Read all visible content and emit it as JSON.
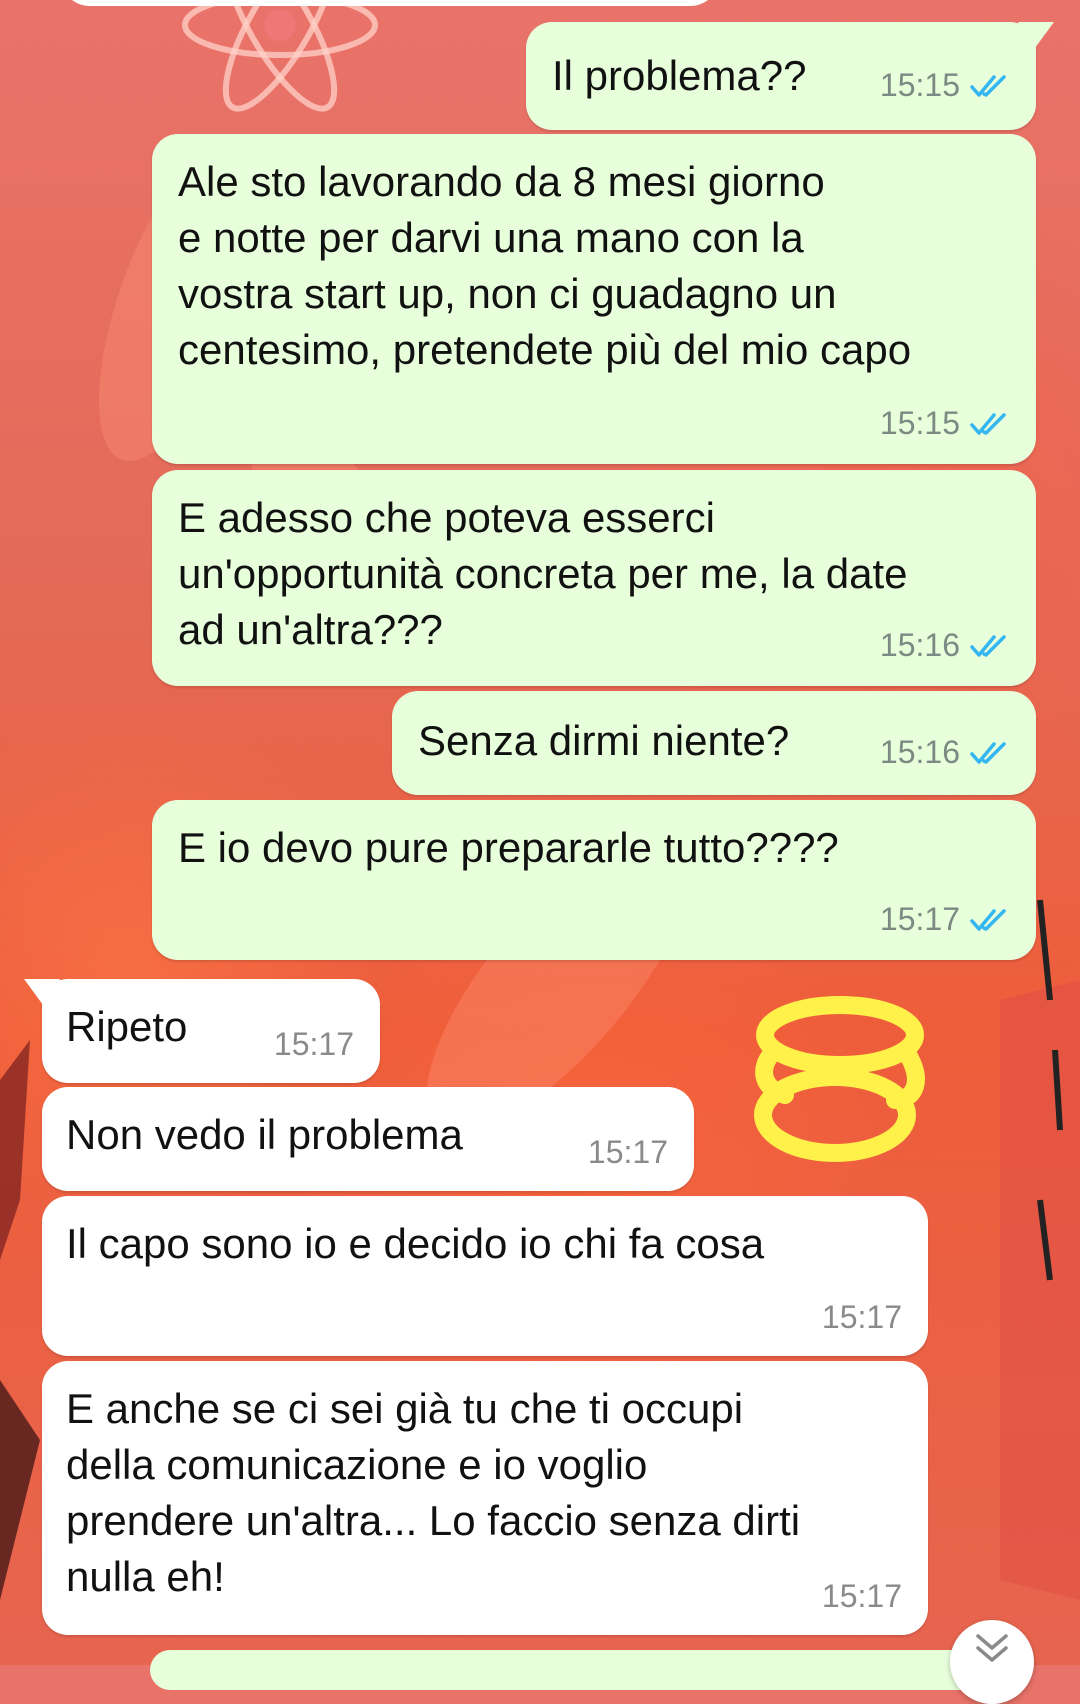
{
  "chat": {
    "messages": [
      {
        "direction": "outgoing",
        "text": "Il problema??",
        "time": "15:15",
        "status": "read"
      },
      {
        "direction": "outgoing",
        "text": "Ale sto lavorando da 8 mesi giorno\ne notte per darvi una mano con la\nvostra start up, non ci guadagno un\ncentesimo, pretendete più del mio capo",
        "time": "15:15",
        "status": "read"
      },
      {
        "direction": "outgoing",
        "text": "E adesso che poteva esserci\nun'opportunità concreta per me, la date\nad un'altra???",
        "time": "15:16",
        "status": "read"
      },
      {
        "direction": "outgoing",
        "text": "Senza dirmi niente?",
        "time": "15:16",
        "status": "read"
      },
      {
        "direction": "outgoing",
        "text": "E io devo pure prepararle tutto????",
        "time": "15:17",
        "status": "read"
      },
      {
        "direction": "incoming",
        "text": "Ripeto",
        "time": "15:17"
      },
      {
        "direction": "incoming",
        "text": "Non vedo il problema",
        "time": "15:17"
      },
      {
        "direction": "incoming",
        "text": "Il capo sono io e decido io chi fa cosa",
        "time": "15:17"
      },
      {
        "direction": "incoming",
        "text": "E anche se ci sei già tu che ti occupi\ndella comunicazione e io voglio\nprendere un'altra... Lo faccio senza dirti\nnulla eh!",
        "time": "15:17"
      }
    ]
  },
  "colors": {
    "outgoing_bubble": "#e7ffdb",
    "incoming_bubble": "#ffffff",
    "read_ticks": "#34b7f1",
    "highlight_scribble": "#fff14a"
  },
  "icons": {
    "read_receipt": "double-check-icon",
    "scroll_down": "chevron-double-down-icon"
  }
}
